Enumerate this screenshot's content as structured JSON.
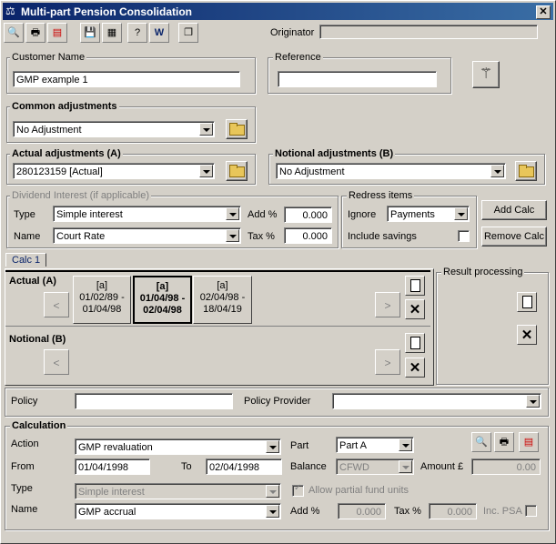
{
  "window": {
    "title": "Multi-part Pension Consolidation",
    "close": "✕"
  },
  "toolbar": {
    "originator_label": "Originator",
    "originator_value": ""
  },
  "customer": {
    "label": "Customer Name",
    "value": "GMP example 1"
  },
  "reference": {
    "label": "Reference",
    "value": ""
  },
  "common": {
    "label": "Common adjustments",
    "value": "No Adjustment"
  },
  "actual_adj": {
    "label": "Actual adjustments (A)",
    "value": "280123159 [Actual]"
  },
  "notional_adj": {
    "label": "Notional adjustments (B)",
    "value": "No Adjustment"
  },
  "dividend": {
    "label": "Dividend Interest (if applicable)",
    "type_label": "Type",
    "type_value": "Simple interest",
    "name_label": "Name",
    "name_value": "Court Rate",
    "add_label": "Add %",
    "add_value": "0.000",
    "tax_label": "Tax %",
    "tax_value": "0.000"
  },
  "redress": {
    "label": "Redress items",
    "ignore_label": "Ignore",
    "ignore_value": "Payments",
    "savings_label": "Include savings"
  },
  "buttons": {
    "add_calc": "Add Calc",
    "remove_calc": "Remove Calc"
  },
  "tabs": [
    {
      "label": "Calc 1"
    }
  ],
  "actual": {
    "label": "Actual (A)",
    "calcs": [
      {
        "line1": "[a]",
        "line2": "01/02/89 -",
        "line3": "01/04/98"
      },
      {
        "line1": "[a]",
        "line2": "01/04/98 -",
        "line3": "02/04/98"
      },
      {
        "line1": "[a]",
        "line2": "02/04/98 -",
        "line3": "18/04/19"
      }
    ]
  },
  "notional": {
    "label": "Notional (B)"
  },
  "result": {
    "label": "Result processing"
  },
  "policy": {
    "label": "Policy",
    "value": "",
    "provider_label": "Policy Provider",
    "provider_value": ""
  },
  "calculation": {
    "label": "Calculation",
    "action_label": "Action",
    "action_value": "GMP revaluation",
    "part_label": "Part",
    "part_value": "Part A",
    "from_label": "From",
    "from_value": "01/04/1998",
    "to_label": "To",
    "to_value": "02/04/1998",
    "balance_label": "Balance",
    "balance_value": "CFWD",
    "amount_label": "Amount £",
    "amount_value": "0.00",
    "type_label": "Type",
    "type_value": "Simple interest",
    "partial_label": "Allow partial fund units",
    "name_label": "Name",
    "name_value": "GMP accrual",
    "add_label": "Add %",
    "add_value": "0.000",
    "tax_label": "Tax %",
    "tax_value": "0.000",
    "psa_label": "Inc. PSA"
  }
}
